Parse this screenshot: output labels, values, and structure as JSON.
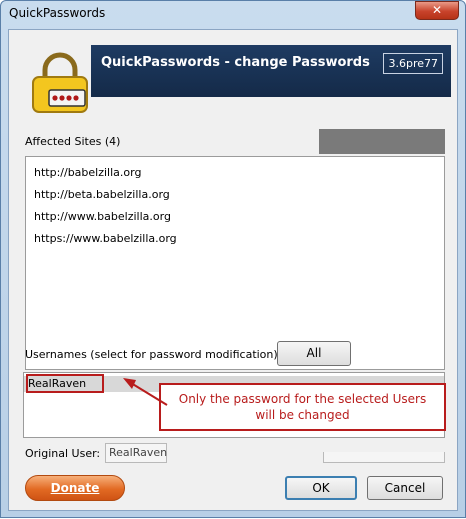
{
  "window": {
    "title": "QuickPasswords",
    "close_icon": "✕"
  },
  "header": {
    "title": "QuickPasswords - change Passwords",
    "version": "3.6pre77"
  },
  "sites": {
    "label": "Affected Sites (4)",
    "items": [
      "http://babelzilla.org",
      "http://beta.babelzilla.org",
      "http://www.babelzilla.org",
      "https://www.babelzilla.org"
    ]
  },
  "usernames": {
    "label": "Usernames (select for password modification)",
    "all_button": "All",
    "items": [
      "RealRaven"
    ]
  },
  "original_user": {
    "label": "Original User:",
    "value": "RealRaven"
  },
  "annotation": {
    "text_line1": "Only the password for the selected Users",
    "text_line2": "will be changed",
    "color": "#b81c1c"
  },
  "footer": {
    "donate": "Donate",
    "ok": "OK",
    "cancel": "Cancel"
  },
  "colors": {
    "banner": "#1e3b62",
    "donate": "#e26a23",
    "title_bar": "#c9dcee"
  }
}
